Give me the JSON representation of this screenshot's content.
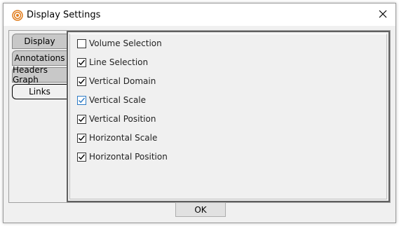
{
  "window": {
    "title": "Display Settings",
    "icon": "target-icon",
    "close_icon": "close-icon"
  },
  "tabs": [
    {
      "label": "Display",
      "active": false
    },
    {
      "label": "Annotations",
      "active": false
    },
    {
      "label": "Headers Graph",
      "active": false
    },
    {
      "label": "Links",
      "active": true
    }
  ],
  "links_options": [
    {
      "label": "Volume Selection",
      "checked": false
    },
    {
      "label": "Line Selection",
      "checked": true
    },
    {
      "label": "Vertical Domain",
      "checked": true
    },
    {
      "label": "Vertical Scale",
      "checked": true
    },
    {
      "label": "Vertical Position",
      "checked": true
    },
    {
      "label": "Horizontal Scale",
      "checked": true
    },
    {
      "label": "Horizontal Position",
      "checked": true
    }
  ],
  "buttons": {
    "ok_label": "OK"
  },
  "colors": {
    "accent": "#2c7ac4",
    "icon_orange": "#e07b1a"
  }
}
